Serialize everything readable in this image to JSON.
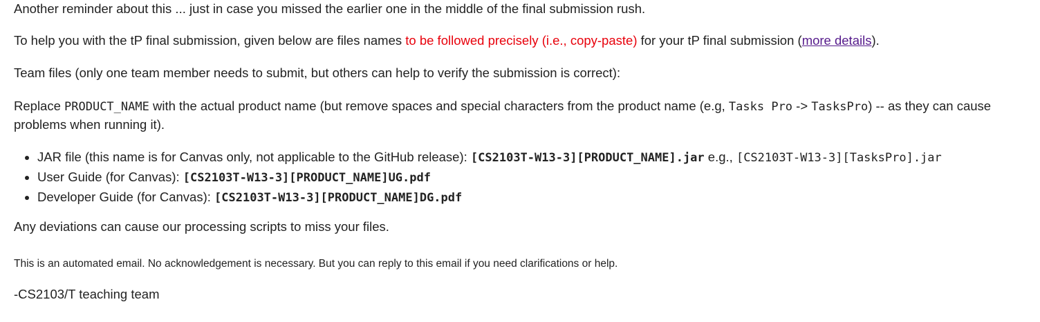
{
  "email": {
    "p1": "Another reminder about this ... just in case you missed the earlier one in the middle of the final submission rush.",
    "p2": {
      "a": "To help you with the tP final submission, given below are files names ",
      "red": "to be followed precisely (i.e., copy-paste)",
      "b": " for your tP final submission (",
      "link": "more details",
      "c": ")."
    },
    "p3": "Team files (only one team member needs to submit, but others can help to verify the submission is correct):",
    "p4": {
      "a": "Replace ",
      "code1": "PRODUCT_NAME",
      "b": " with the actual product name (but remove spaces and special characters from the product name (e.g, ",
      "code2": "Tasks Pro",
      "c": " -> ",
      "code3": "TasksPro",
      "d": ") -- as they can cause problems when running it)."
    },
    "items": [
      {
        "label": "JAR file (this name is for Canvas only, not applicable to the GitHub release): ",
        "code": "[CS2103T-W13-3][PRODUCT_NAME].jar",
        "extra": " e.g., ",
        "example": "[CS2103T-W13-3][TasksPro].jar"
      },
      {
        "label": "User Guide (for Canvas): ",
        "code": "[CS2103T-W13-3][PRODUCT_NAME]UG.pdf"
      },
      {
        "label": "Developer Guide (for Canvas): ",
        "code": "[CS2103T-W13-3][PRODUCT_NAME]DG.pdf"
      }
    ],
    "p5": "Any deviations can cause our processing scripts to miss your files.",
    "p6": "This is an automated email. No acknowledgement is necessary. But you can reply to this email if you need clarifications or help.",
    "p7": "-CS2103/T teaching team"
  }
}
